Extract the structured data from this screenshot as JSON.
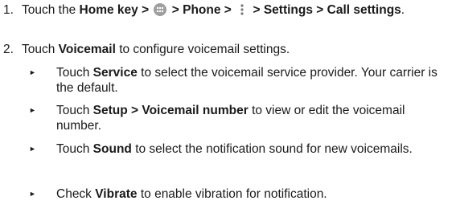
{
  "steps": [
    {
      "number": "1.",
      "parts": {
        "a": "Touch the ",
        "home": "Home",
        "b": " key > ",
        "c": " > Phone > ",
        "d": " > Settings > Call settings",
        "e": "."
      },
      "icons": [
        "apps-grid-icon",
        "more-options-icon"
      ]
    },
    {
      "number": "2.",
      "parts": {
        "a": "Touch ",
        "voicemail": "Voicemail",
        "b": " to configure voicemail settings."
      }
    }
  ],
  "bullets": [
    {
      "mark": "►",
      "a": "Touch ",
      "bold": "Service",
      "b": " to select the voicemail service provider. Your carrier is the default."
    },
    {
      "mark": "►",
      "a": "Touch ",
      "bold": "Setup > Voicemail number",
      "b": " to view or edit the voicemail number."
    },
    {
      "mark": "►",
      "a": "Touch ",
      "bold": "Sound",
      "b": " to select the notification sound for new voicemails."
    },
    {
      "mark": "►",
      "a": "Check ",
      "bold": "Vibrate",
      "b": " to enable vibration for notification."
    }
  ]
}
